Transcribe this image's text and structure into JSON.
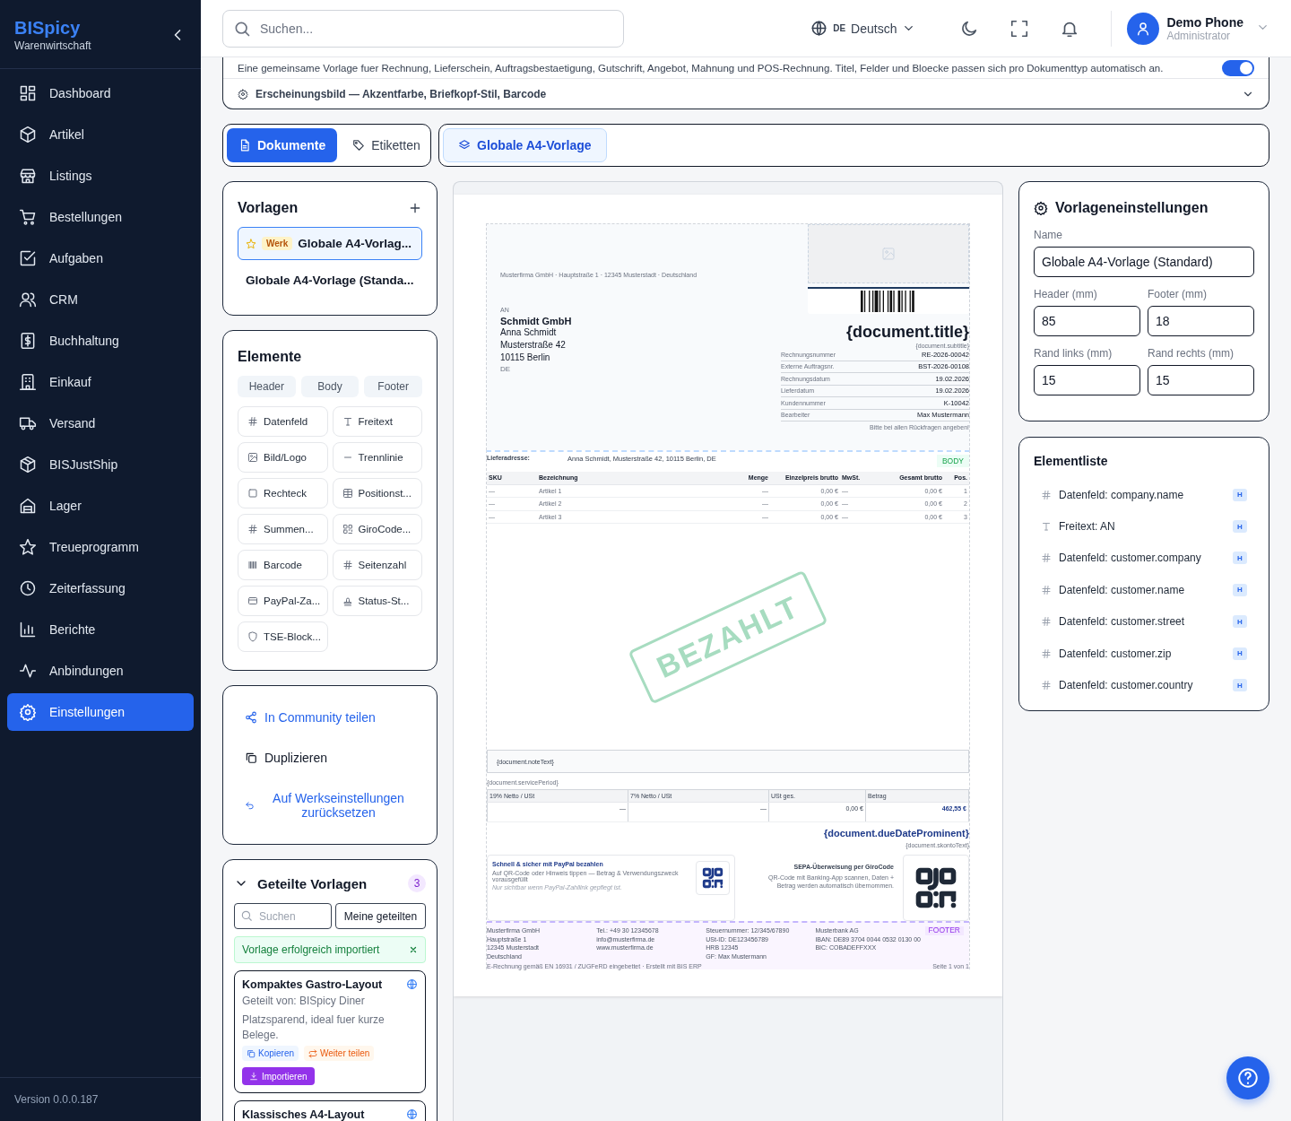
{
  "sidebar": {
    "brand": "BISpicy",
    "subtitle": "Warenwirtschaft",
    "items": [
      {
        "label": "Dashboard",
        "selected": false
      },
      {
        "label": "Artikel",
        "selected": false
      },
      {
        "label": "Listings",
        "selected": false
      },
      {
        "label": "Bestellungen",
        "selected": false
      },
      {
        "label": "Aufgaben",
        "selected": false
      },
      {
        "label": "CRM",
        "selected": false
      },
      {
        "label": "Buchhaltung",
        "selected": false
      },
      {
        "label": "Einkauf",
        "selected": false
      },
      {
        "label": "Versand",
        "selected": false
      },
      {
        "label": "BISJustShip",
        "selected": false
      },
      {
        "label": "Lager",
        "selected": false
      },
      {
        "label": "Treueprogramm",
        "selected": false
      },
      {
        "label": "Zeiterfassung",
        "selected": false
      },
      {
        "label": "Berichte",
        "selected": false
      },
      {
        "label": "Anbindungen",
        "selected": false
      },
      {
        "label": "Einstellungen",
        "selected": true
      }
    ],
    "version": "Version 0.0.0.187"
  },
  "topbar": {
    "search": {
      "placeholder": "Suchen..."
    },
    "language": {
      "code": "DE",
      "label": "Deutsch"
    },
    "user": {
      "name": "Demo Phone",
      "role": "Administrator"
    }
  },
  "template_info": {
    "description": "Eine gemeinsame Vorlage fuer Rechnung, Lieferschein, Auftragsbestaetigung, Gutschrift, Angebot, Mahnung und POS-Rechnung. Titel, Felder und Bloecke passen sich pro Dokumenttyp automatisch an.",
    "toggle_on": true,
    "appearance": {
      "label": "Erscheinungsbild — Akzentfarbe, Briefkopf-Stil, Barcode",
      "expanded": false
    }
  },
  "mode_tabs": [
    {
      "label": "Dokumente",
      "selected": true
    },
    {
      "label": "Etiketten",
      "selected": false
    }
  ],
  "template_tabs": [
    {
      "label": "Globale A4-Vorlage",
      "selected": true
    }
  ],
  "templates": {
    "title": "Vorlagen",
    "items": [
      {
        "badge": "Werk",
        "name": "Globale A4-Vorlag...",
        "selected": true
      },
      {
        "name": "Globale A4-Vorlage (Standa...",
        "selected": false
      }
    ]
  },
  "elements": {
    "title": "Elemente",
    "sections": [
      "Header",
      "Body",
      "Footer"
    ],
    "items": [
      "Datenfeld",
      "Freitext",
      "Bild/Logo",
      "Trennlinie",
      "Rechteck",
      "Positionst...",
      "Summen...",
      "GiroCode...",
      "Barcode",
      "Seitenzahl",
      "PayPal-Za...",
      "Status-St...",
      "TSE-Block..."
    ]
  },
  "actions": [
    {
      "label": "In Community teilen",
      "kind": "link"
    },
    {
      "label": "Duplizieren",
      "kind": "plain"
    },
    {
      "label": "Auf Werkseinstellungen zurücksetzen",
      "kind": "link"
    }
  ],
  "shared": {
    "title": "Geteilte Vorlagen",
    "expanded": true,
    "count": "3",
    "search": {
      "placeholder": "Suchen"
    },
    "mine_button": "Meine geteilten",
    "message": "Vorlage erfolgreich importiert",
    "cards": [
      {
        "title": "Kompaktes Gastro-Layout",
        "author": "Geteilt von: BISpicy Diner",
        "description": "Platzsparend, ideal fuer kurze Belege.",
        "copy": "Kopieren",
        "forward": "Weiter teilen",
        "import": "Importieren"
      },
      {
        "title": "Klassisches A4-Layout"
      }
    ]
  },
  "document": {
    "sender_line": "Musterfirma GmbH · Hauptstraße 1 · 12345 Musterstadt · Deutschland",
    "recipient_label": "AN",
    "recipient_company": "Schmidt GmbH",
    "recipient_lines": [
      "Anna Schmidt",
      "Musterstraße 42",
      "10115 Berlin"
    ],
    "recipient_country": "DE",
    "title": "{document.title}",
    "subtitle": "{document.subtitle}",
    "meta": [
      {
        "label": "Rechnungsnummer",
        "value": "RE-2026-00042"
      },
      {
        "label": "Externe Auftragsnr.",
        "value": "BST-2026-00108"
      },
      {
        "label": "Rechnungsdatum",
        "value": "19.02.2026"
      },
      {
        "label": "Lieferdatum",
        "value": "19.02.2026"
      },
      {
        "label": "Kundennummer",
        "value": "K-10042"
      },
      {
        "label": "Bearbeiter",
        "value": "Max Mustermann"
      }
    ],
    "meta_note": "Bitte bei allen Rückfragen angeben!",
    "delivery_label": "Lieferadresse:",
    "delivery_address": "Anna Schmidt, Musterstraße 42, 10115 Berlin, DE",
    "body_tag": "BODY",
    "table": {
      "columns": [
        "SKU",
        "Bezeichnung",
        "Menge",
        "Einzelpreis brutto",
        "MwSt.",
        "Gesamt brutto",
        "Pos."
      ],
      "rows": [
        [
          "—",
          "Artikel 1",
          "—",
          "0,00 €",
          "—",
          "0,00 €",
          "1"
        ],
        [
          "—",
          "Artikel 2",
          "—",
          "0,00 €",
          "—",
          "0,00 €",
          "2"
        ],
        [
          "—",
          "Artikel 3",
          "—",
          "0,00 €",
          "—",
          "0,00 €",
          "3"
        ]
      ]
    },
    "stamp": "BEZAHLT",
    "note": "{document.noteText}",
    "service_period": "{document.servicePeriod}",
    "totals": {
      "columns": [
        "19% Netto / USt",
        "7% Netto / USt",
        "USt ges.",
        "Betrag"
      ],
      "values": [
        "—",
        "—",
        "0,00 €",
        "462,55 €"
      ]
    },
    "due_date": "{document.dueDateProminent}",
    "skonto": "{document.skontoText}",
    "paypal": {
      "title": "Schnell & sicher mit PayPal bezahlen",
      "text": "Auf QR-Code oder Hinweis tippen — Betrag & Verwendungszweck vorausgefüllt",
      "note": "Nur sichtbar wenn PayPal-Zahllink gepflegt ist."
    },
    "girocode": {
      "title": "SEPA-Überweisung per GiroCode",
      "text": "QR-Code mit Banking-App scannen, Daten + Betrag werden automatisch übernommen."
    },
    "footer_tag": "FOOTER",
    "footer_columns": [
      [
        "Musterfirma GmbH",
        "Hauptstraße 1",
        "12345 Musterstadt",
        "Deutschland"
      ],
      [
        "Tel.: +49 30 12345678",
        "info@musterfirma.de",
        "www.musterfirma.de"
      ],
      [
        "Steuernummer: 12/345/67890",
        "USt-ID: DE123456789",
        "HRB 12345",
        "GF: Max Mustermann"
      ],
      [
        "Musterbank AG",
        "IBAN: DE89 3704 0044 0532 0130 00",
        "BIC: COBADEFFXXX"
      ]
    ],
    "footer_left": "E-Rechnung gemäß EN 16931 / ZUGFeRD eingebettet · Erstellt mit BIS ERP",
    "footer_right": "Seite 1 von 1"
  },
  "settings": {
    "title": "Vorlageneinstellungen",
    "fields": [
      {
        "label": "Name",
        "value": "Globale A4-Vorlage (Standard)"
      },
      {
        "label": "Header (mm)",
        "value": "85"
      },
      {
        "label": "Footer (mm)",
        "value": "18"
      },
      {
        "label": "Rand links (mm)",
        "value": "15"
      },
      {
        "label": "Rand rechts (mm)",
        "value": "15"
      }
    ]
  },
  "element_list": {
    "title": "Elementliste",
    "items": [
      {
        "kind": "field",
        "label": "Datenfeld: company.name",
        "tag": "H"
      },
      {
        "kind": "text",
        "label": "Freitext: AN",
        "tag": "H"
      },
      {
        "kind": "field",
        "label": "Datenfeld: customer.company",
        "tag": "H"
      },
      {
        "kind": "field",
        "label": "Datenfeld: customer.name",
        "tag": "H"
      },
      {
        "kind": "field",
        "label": "Datenfeld: customer.street",
        "tag": "H"
      },
      {
        "kind": "field",
        "label": "Datenfeld: customer.zip",
        "tag": "H"
      },
      {
        "kind": "field",
        "label": "Datenfeld: customer.country",
        "tag": "H"
      }
    ]
  }
}
